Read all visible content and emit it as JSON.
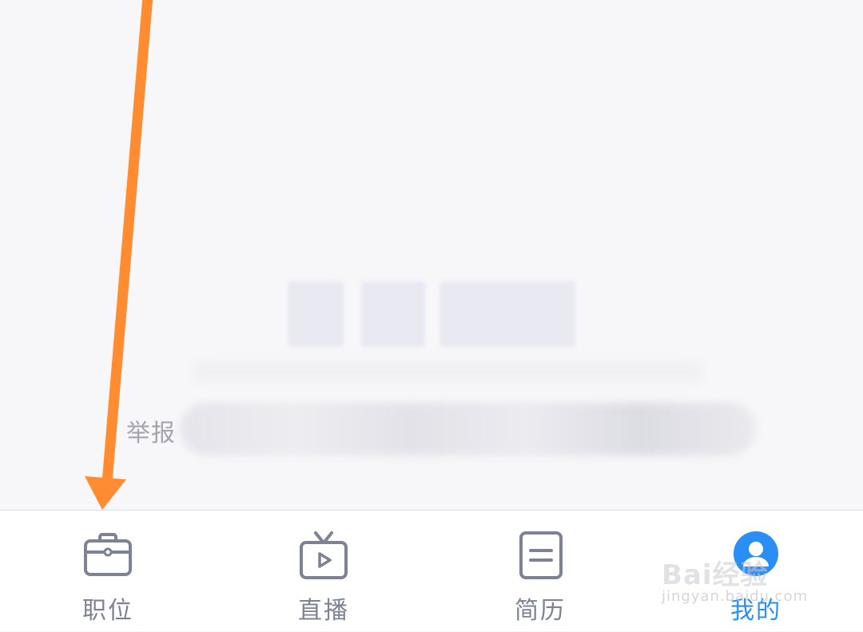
{
  "content": {
    "report_prefix": "举报"
  },
  "tabbar": {
    "tabs": [
      {
        "label": "职位",
        "icon": "briefcase-icon",
        "active": false
      },
      {
        "label": "直播",
        "icon": "tv-play-icon",
        "active": false
      },
      {
        "label": "简历",
        "icon": "resume-document-icon",
        "active": false
      },
      {
        "label": "我的",
        "icon": "profile-avatar-icon",
        "active": true
      }
    ]
  },
  "watermark": {
    "text": "Bai经验",
    "url": "jingyan.baidu.com"
  },
  "colors": {
    "active": "#2a8ff4",
    "inactive": "#7d8294",
    "arrow": "#ff8c30",
    "background": "#f7f7f9"
  }
}
